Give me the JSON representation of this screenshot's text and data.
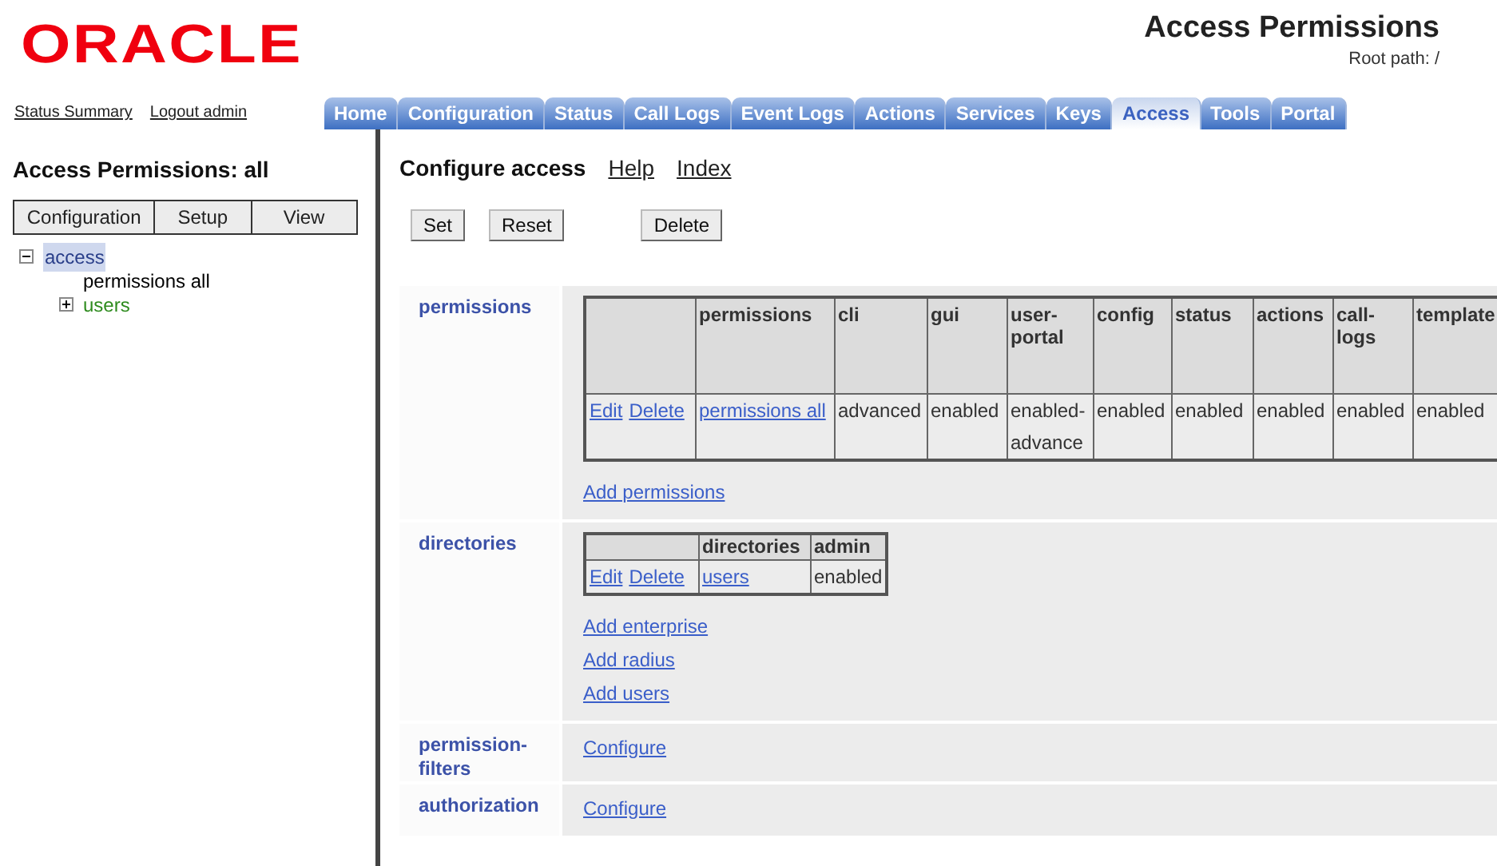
{
  "logo": "ORACLE",
  "header": {
    "title": "Access Permissions",
    "root_path": "Root path: /"
  },
  "top_links": [
    "Status Summary",
    "Logout admin"
  ],
  "tabs": [
    {
      "label": "Home",
      "selected": false
    },
    {
      "label": "Configuration",
      "selected": false
    },
    {
      "label": "Status",
      "selected": false
    },
    {
      "label": "Call Logs",
      "selected": false
    },
    {
      "label": "Event Logs",
      "selected": false
    },
    {
      "label": "Actions",
      "selected": false
    },
    {
      "label": "Services",
      "selected": false
    },
    {
      "label": "Keys",
      "selected": false
    },
    {
      "label": "Access",
      "selected": true
    },
    {
      "label": "Tools",
      "selected": false
    },
    {
      "label": "Portal",
      "selected": false
    }
  ],
  "sidebar": {
    "title": "Access Permissions: all",
    "buttons": [
      "Configuration",
      "Setup",
      "View"
    ],
    "tree": [
      {
        "label": "access",
        "kind": "branch",
        "expanded": true,
        "selected": true,
        "children": [
          {
            "label": "permissions all",
            "kind": "leaf",
            "selected": false
          },
          {
            "label": "users",
            "kind": "branch",
            "expanded": false,
            "selected": false
          }
        ]
      }
    ]
  },
  "main": {
    "title": "Configure access",
    "links": [
      "Help",
      "Index"
    ],
    "buttons": [
      {
        "label": "Set",
        "kind": "normal"
      },
      {
        "label": "Reset",
        "kind": "normal"
      },
      {
        "label": "Delete",
        "kind": "separated"
      }
    ],
    "sections": [
      {
        "label": "permissions",
        "kind": "table",
        "columns": [
          "",
          "permissions",
          "cli",
          "gui",
          "user-portal",
          "config",
          "status",
          "actions",
          "call-logs",
          "template"
        ],
        "rows": [
          {
            "cells": [
              {
                "kind": "actions",
                "links": [
                  "Edit",
                  "Delete"
                ]
              },
              {
                "kind": "link",
                "text": "permissions all"
              },
              {
                "kind": "text",
                "text": "advanced"
              },
              {
                "kind": "text",
                "text": "enabled"
              },
              {
                "kind": "text",
                "text": "enabled-advance"
              },
              {
                "kind": "text",
                "text": "enabled"
              },
              {
                "kind": "text",
                "text": "enabled"
              },
              {
                "kind": "text",
                "text": "enabled"
              },
              {
                "kind": "text",
                "text": "enabled"
              },
              {
                "kind": "text",
                "text": "enabled"
              }
            ]
          }
        ],
        "links": [
          "Add permissions"
        ]
      },
      {
        "label": "directories",
        "kind": "table",
        "columns": [
          "",
          "directories",
          "admin"
        ],
        "rows": [
          {
            "cells": [
              {
                "kind": "actions",
                "links": [
                  "Edit",
                  "Delete"
                ]
              },
              {
                "kind": "link",
                "text": "users"
              },
              {
                "kind": "text",
                "text": "enabled"
              }
            ]
          }
        ],
        "links": [
          "Add enterprise",
          "Add radius",
          "Add users"
        ]
      },
      {
        "label": "permission-filters",
        "kind": "links",
        "links": [
          "Configure"
        ]
      },
      {
        "label": "authorization",
        "kind": "links",
        "links": [
          "Configure"
        ]
      }
    ]
  }
}
